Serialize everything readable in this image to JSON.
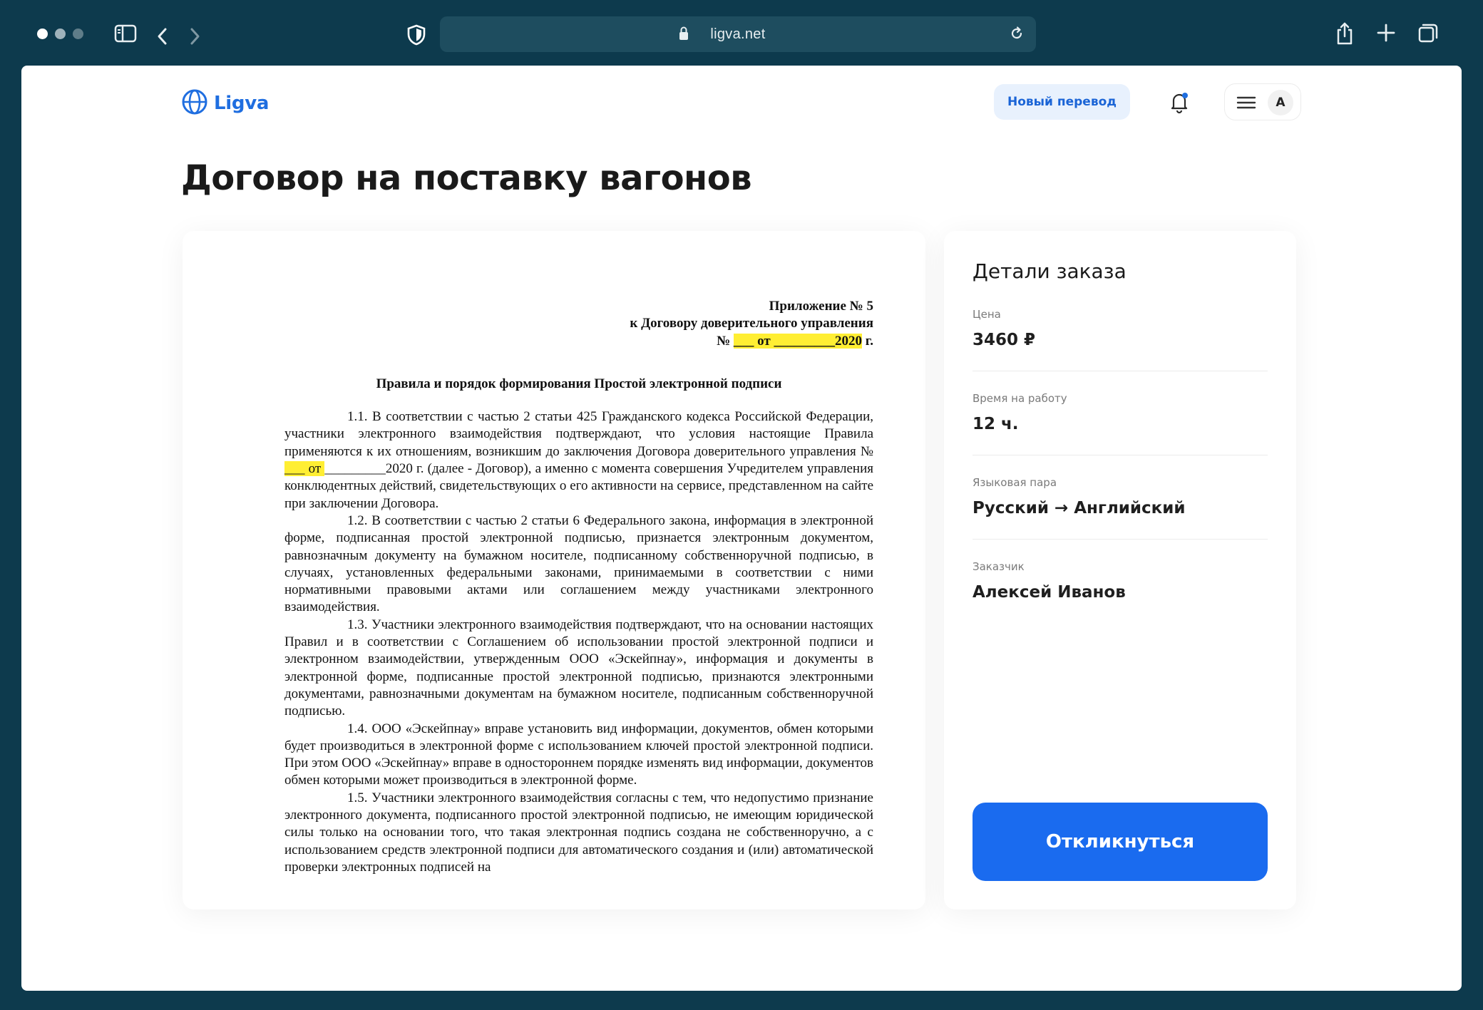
{
  "browser": {
    "url": "ligva.net",
    "dot_colors": [
      "#ffffff",
      "#9fb2bb",
      "#5f7d89"
    ]
  },
  "header": {
    "logo_text": "Ligva",
    "new_translation_label": "Новый перевод",
    "avatar_letter": "A"
  },
  "page": {
    "title": "Договор на поставку вагонов"
  },
  "document": {
    "head": {
      "line1": "Приложение № 5",
      "line2": "к Договору доверительного управления",
      "line3_no": "№ ",
      "line3_highlight": "___ от _________2020",
      "line3_suffix": " г."
    },
    "title": "Правила и порядок формирования Простой электронной подписи",
    "p1_a": "1.1. В соответствии с частью 2 статьи 425 Гражданского кодекса Российской Федерации, участники электронного взаимодействия подтверждают, что условия настоящие Правила применяются к их отношениям, возникшим до заключения Договора доверительного управления № ",
    "p1_hl": "___ от ",
    "p1_b": "_________2020 г. (далее - Договор), а именно с момента совершения Учредителем управления конклюдентных действий, свидетельствующих о его активности на сервисе, представленном на сайте при заключении Договора.",
    "p2": "1.2. В соответствии с частью 2 статьи 6 Федерального закона, информация в электронной форме, подписанная простой электронной подписью, признается электронным документом, равнозначным документу на бумажном носителе, подписанному собственноручной подписью, в случаях, установленных федеральными законами, принимаемыми в соответствии с ними нормативными правовыми актами или соглашением между участниками электронного взаимодействия.",
    "p3": "1.3. Участники электронного взаимодействия подтверждают, что на основании настоящих Правил и в соответствии с Соглашением об использовании простой электронной подписи и электронном взаимодействии, утвержденным ООО «Эскейпнау», информация и документы в электронной форме, подписанные простой электронной подписью, признаются электронными документами, равнозначными документам на бумажном носителе, подписанным собственноручной подписью.",
    "p4": "1.4. ООО «Эскейпнау» вправе установить вид информации, документов, обмен которыми будет производиться в электронной форме с использованием ключей простой электронной подписи. При этом ООО «Эскейпнау» вправе в одностороннем порядке изменять вид информации, документов обмен которыми может производиться в электронной форме.",
    "p5": "1.5. Участники электронного взаимодействия согласны с тем, что недопустимо признание электронного документа, подписанного простой электронной подписью, не имеющим юридической силы только на основании того, что такая электронная подпись создана не собственноручно, а с использованием средств электронной подписи для автоматического создания и (или) автоматической проверки электронных подписей на"
  },
  "details": {
    "title": "Детали заказа",
    "price_label": "Цена",
    "price_value": "3460 ₽",
    "time_label": "Время на работу",
    "time_value": "12 ч.",
    "lang_label": "Языковая пара",
    "lang_value": "Русский → Английский",
    "customer_label": "Заказчик",
    "customer_value": "Алексей Иванов",
    "respond_label": "Откликнуться"
  }
}
